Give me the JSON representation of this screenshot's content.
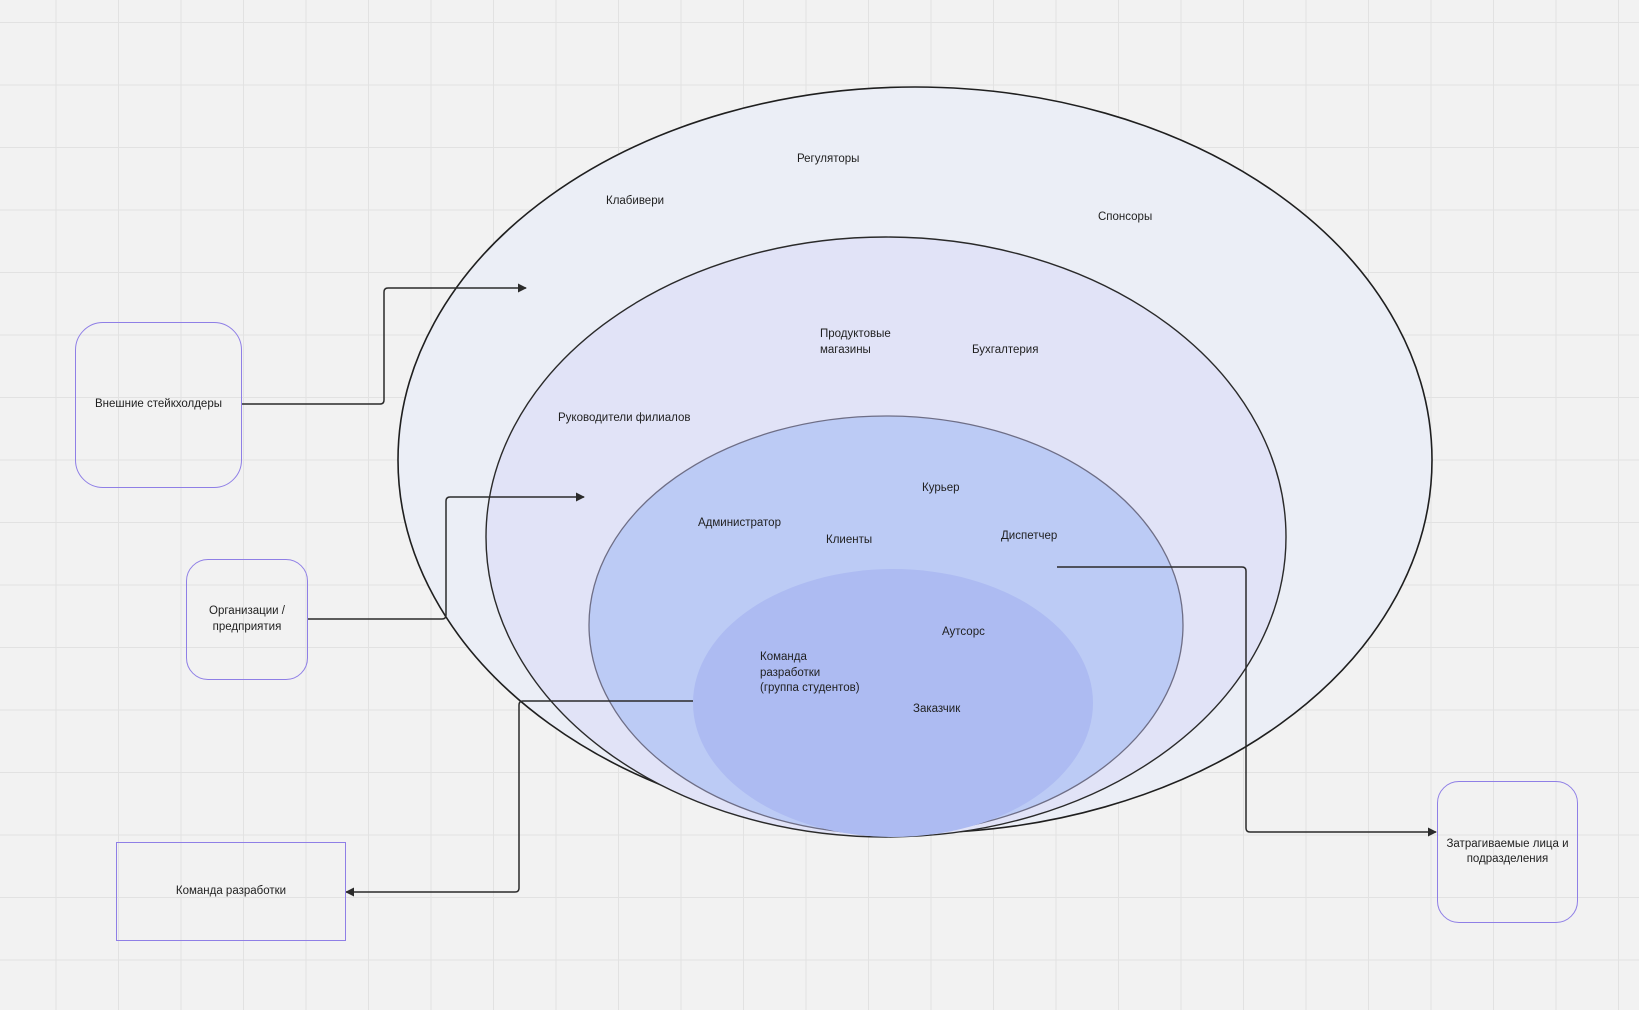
{
  "rings": [
    {
      "name": "outer",
      "fill": "#ebeef6"
    },
    {
      "name": "middle",
      "fill": "#e1e3f7"
    },
    {
      "name": "inner",
      "fill": "#bccbf5"
    },
    {
      "name": "core",
      "fill": "#adbbf2"
    }
  ],
  "labels": {
    "regulators": "Регуляторы",
    "clubs": "Клабивери",
    "sponsors": "Спонсоры",
    "grocery": "Продуктовые\nмагазины",
    "accounting": "Бухгалтерия",
    "branch_heads": "Руководители филиалов",
    "courier": "Курьер",
    "administrator": "Администратор",
    "clients": "Клиенты",
    "dispatcher": "Диспетчер",
    "outsource": "Аутсорс",
    "dev_team_students": "Команда\nразработки\n(группа студентов)",
    "customer": "Заказчик"
  },
  "boxes": {
    "external": "Внешние стейкхолдеры",
    "organizations": "Организации /\nпредприятия",
    "dev_team": "Команда разработки",
    "affected": "Затрагиваемые лица и\nподразделения"
  },
  "colors": {
    "box_border": "#8f7fe6",
    "connector": "#2b2b2b",
    "ring_stroke_outer": "#1f1f1f",
    "ring_stroke_inner": "#707080"
  }
}
